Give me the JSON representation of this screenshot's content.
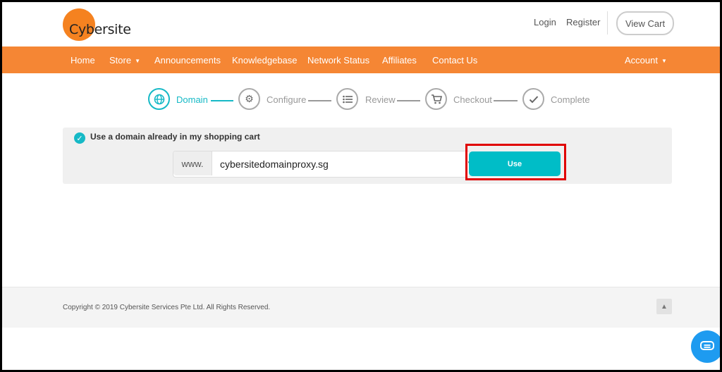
{
  "brand": {
    "name": "Cybersite",
    "accent": "#f58634",
    "teal": "#16b9c6"
  },
  "top": {
    "login": "Login",
    "register": "Register",
    "view_cart": "View Cart"
  },
  "nav": {
    "items": [
      "Home",
      "Store",
      "Announcements",
      "Knowledgebase",
      "Network Status",
      "Affiliates",
      "Contact Us"
    ],
    "account": "Account"
  },
  "steps": [
    {
      "label": "Domain",
      "icon": "globe-icon",
      "active": true
    },
    {
      "label": "Configure",
      "icon": "gear-icon",
      "active": false
    },
    {
      "label": "Review",
      "icon": "list-icon",
      "active": false
    },
    {
      "label": "Checkout",
      "icon": "cart-icon",
      "active": false
    },
    {
      "label": "Complete",
      "icon": "check-icon",
      "active": false
    }
  ],
  "domain_panel": {
    "title": "Use a domain already in my shopping cart",
    "prefix": "www.",
    "selected_domain": "cybersitedomainproxy.sg",
    "use_button": "Use"
  },
  "footer": {
    "copyright": "Copyright © 2019 Cybersite Services Pte Ltd. All Rights Reserved."
  }
}
